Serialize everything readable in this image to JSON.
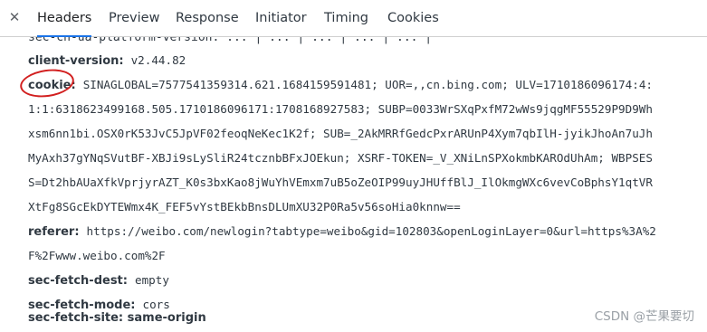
{
  "tabs": [
    "Headers",
    "Preview",
    "Response",
    "Initiator",
    "Timing",
    "Cookies"
  ],
  "clipped_top_text": "sec-ch-ua-platform-version: ... | ... | ... | ... | ... |",
  "headers": [
    {
      "name": "client-version:",
      "value": "v2.44.82"
    },
    {
      "name": "cookie:",
      "value": "SINAGLOBAL=7577541359314.621.1684159591481; UOR=,,cn.bing.com; ULV=1710186096174:4:"
    },
    {
      "name": "referer:",
      "value": "https://weibo.com/newlogin?tabtype=weibo&gid=102803&openLoginLayer=0&url=https%3A%2"
    },
    {
      "name": "sec-fetch-dest:",
      "value": "empty"
    },
    {
      "name": "sec-fetch-mode:",
      "value": "cors"
    }
  ],
  "cookie_lines": [
    "1:1:6318623499168.505.1710186096171:1708168927583; SUBP=0033WrSXqPxfM72wWs9jqgMF55529P9D9Wh",
    "xsm6nn1bi.OSX0rK53JvC5JpVF02feoqNeKec1K2f; SUB=_2AkMRRfGedcPxrARUnP4Xym7qbIlH-jyikJhoAn7uJh",
    "MyAxh37gYNqSVutBF-XBJi9sLySliR24tcznbBFxJOEkun; XSRF-TOKEN=_V_XNiLnSPXokmbKAROdUhAm; WBPSES",
    "S=Dt2hbAUaXfkVprjyrAZT_K0s3bxKao8jWuYhVEmxm7uB5oZeOIP99uyJHUffBlJ_IlOkmgWXc6vevCoBphsY1qtVR",
    "XtFg8SGcEkDYTEWmx4K_FEF5vYstBEkbBnsDLUmXU32P0Ra5v56soHia0knnw=="
  ],
  "referer_line2": "F%2Fwww.weibo.com%2F",
  "bottom_clipped": "sec-fetch-site: same-origin",
  "watermark": "CSDN @芒果要切",
  "colors": {
    "accent": "#1a73e8",
    "annotation": "#d21f1f"
  }
}
